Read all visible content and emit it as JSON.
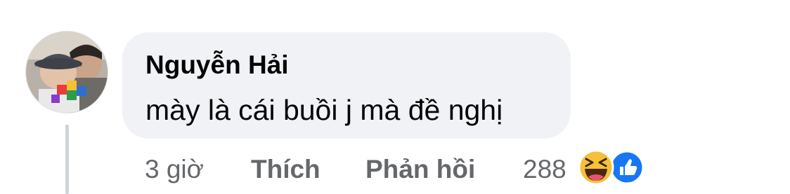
{
  "comment": {
    "author": "Nguyễn Hải",
    "text": "mày là cái buồi j mà đề nghị"
  },
  "actions": {
    "time": "3 giờ",
    "like_label": "Thích",
    "reply_label": "Phản hồi"
  },
  "reactions": {
    "count": "288",
    "icons": [
      "haha-icon",
      "like-icon"
    ]
  },
  "colors": {
    "bubble": "#f0f2f5",
    "name_text": "#050505",
    "meta_text": "#65676b",
    "like_blue": "#1877f2",
    "haha_yellow": "#f7c03a"
  }
}
